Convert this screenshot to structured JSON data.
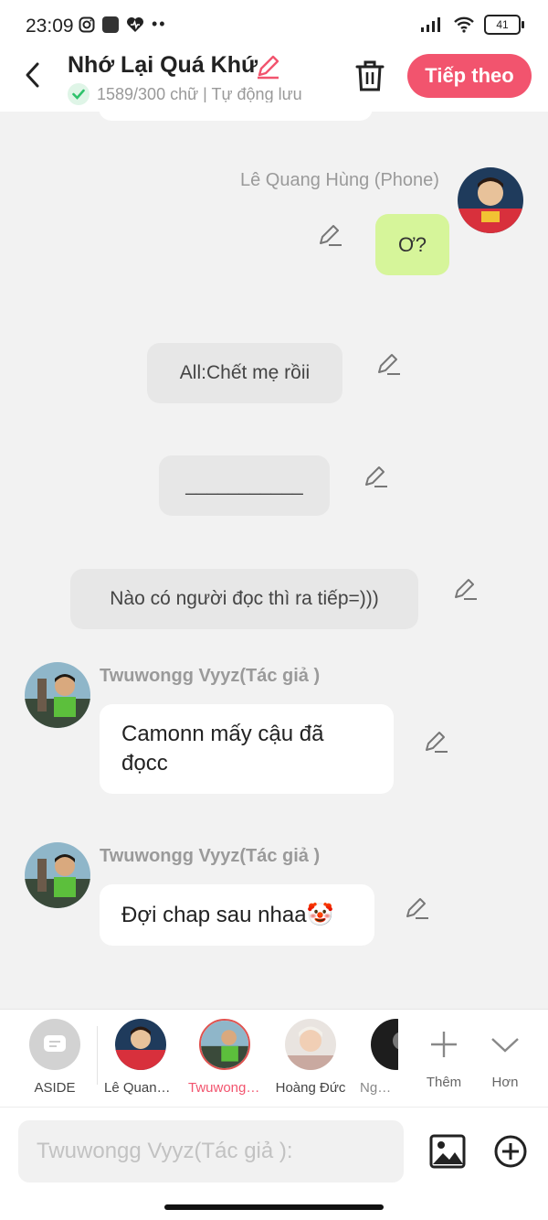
{
  "status": {
    "time": "23:09",
    "battery": "41"
  },
  "header": {
    "title": "Nhớ Lại Quá Khứ",
    "subtitle": "1589/300 chữ | Tự động lưu",
    "next_label": "Tiếp theo"
  },
  "messages": {
    "phone": {
      "name": "Lê Quang Hùng (Phone)",
      "text": "Ơ?"
    },
    "aside1": "All:Chết mẹ rồii",
    "aside2": "___________",
    "aside3": "Nào có người đọc thì ra tiếp=)))",
    "author1": {
      "name": "Twuwongg Vyyz(Tác giả )",
      "text": "Camonn mấy cậu đã đọcc"
    },
    "author2": {
      "name": "Twuwongg Vyyz(Tác giả )",
      "text": "Đợi chap sau nhaa🤡"
    }
  },
  "characters": {
    "aside": "ASIDE",
    "c1": "Lê Quang Hùng (Phone)",
    "c2": "Twuwongg Vyyz(Tác giả )",
    "c3": "Hoàng Đức",
    "c4": "Nguyễn",
    "more": "Thêm",
    "expand": "Hơn"
  },
  "input": {
    "placeholder": "Twuwongg Vyyz(Tác giả ):"
  },
  "colors": {
    "accent": "#f2546e",
    "author_bubble": "#d6f59a",
    "selected_ring": "#e0524f"
  }
}
